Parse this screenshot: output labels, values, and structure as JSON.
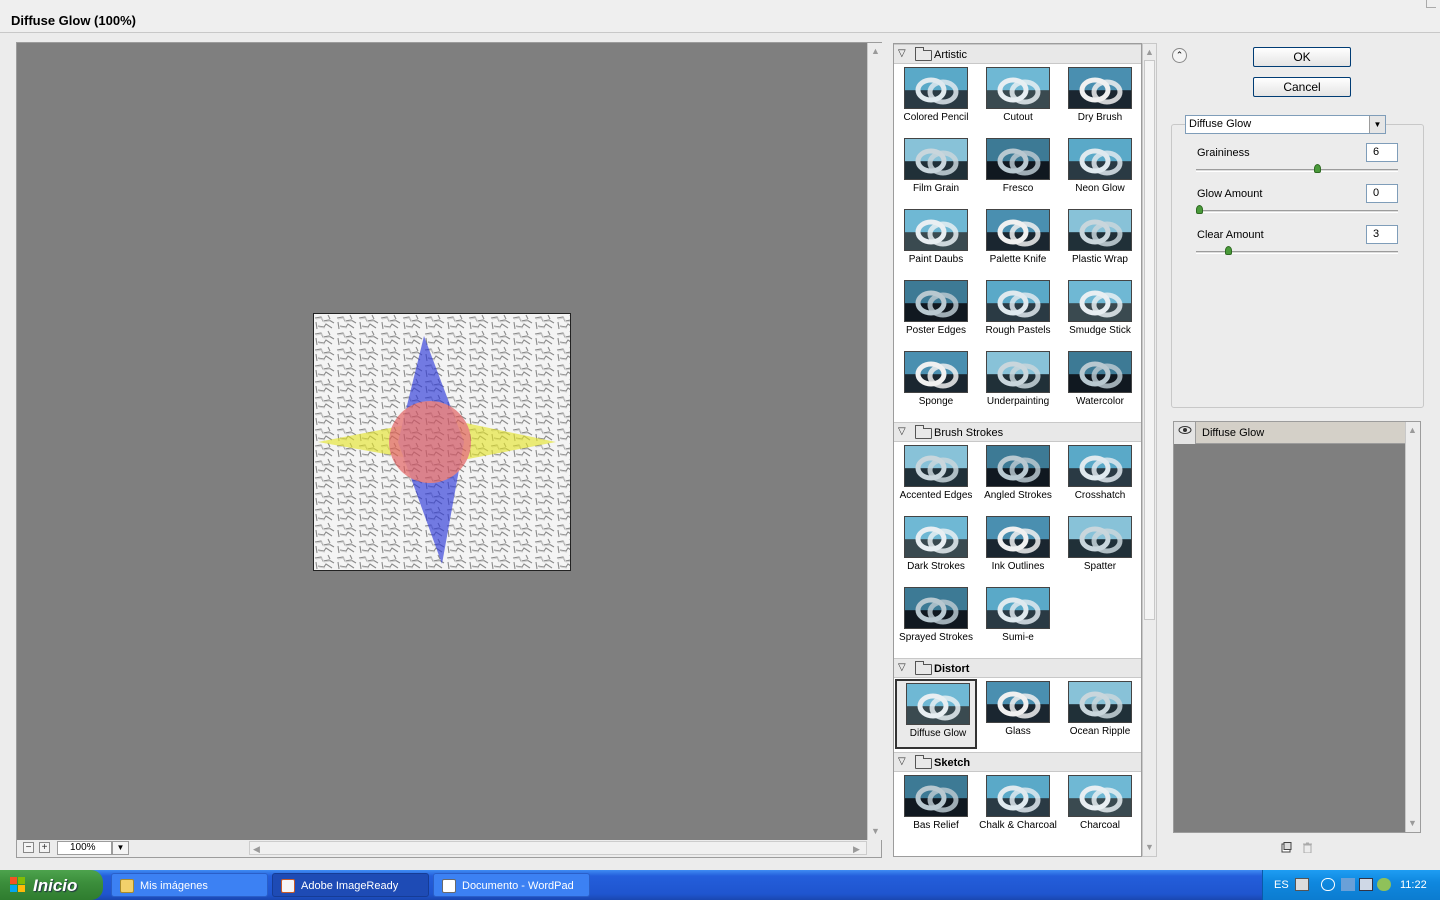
{
  "window": {
    "title": "Diffuse Glow (100%)"
  },
  "preview": {
    "zoom": "100%",
    "zoom_out": "−",
    "zoom_in": "+"
  },
  "gallery": {
    "categories": [
      {
        "name": "Artistic",
        "expanded": true,
        "filters": [
          "Colored Pencil",
          "Cutout",
          "Dry Brush",
          "Film Grain",
          "Fresco",
          "Neon Glow",
          "Paint Daubs",
          "Palette Knife",
          "Plastic Wrap",
          "Poster Edges",
          "Rough Pastels",
          "Smudge Stick",
          "Sponge",
          "Underpainting",
          "Watercolor"
        ]
      },
      {
        "name": "Brush Strokes",
        "expanded": true,
        "filters": [
          "Accented Edges",
          "Angled Strokes",
          "Crosshatch",
          "Dark Strokes",
          "Ink Outlines",
          "Spatter",
          "Sprayed Strokes",
          "Sumi-e"
        ]
      },
      {
        "name": "Distort",
        "expanded": true,
        "filters": [
          "Diffuse Glow",
          "Glass",
          "Ocean Ripple"
        ]
      },
      {
        "name": "Sketch",
        "expanded": true,
        "filters": [
          "Bas Relief",
          "Chalk & Charcoal",
          "Charcoal"
        ]
      }
    ],
    "selected_filter": "Diffuse Glow"
  },
  "buttons": {
    "ok": "OK",
    "cancel": "Cancel"
  },
  "settings": {
    "filter": "Diffuse Glow",
    "params": [
      {
        "label": "Graininess",
        "value": "6",
        "fraction": 0.6
      },
      {
        "label": "Glow Amount",
        "value": "0",
        "fraction": 0.0
      },
      {
        "label": "Clear Amount",
        "value": "3",
        "fraction": 0.15
      }
    ]
  },
  "layers": {
    "items": [
      "Diffuse Glow"
    ]
  },
  "taskbar": {
    "start": "Inicio",
    "tasks": [
      "Mis imágenes",
      "Adobe ImageReady",
      "Documento - WordPad"
    ],
    "active_task": "Adobe ImageReady",
    "lang": "ES",
    "clock": "11:22"
  }
}
